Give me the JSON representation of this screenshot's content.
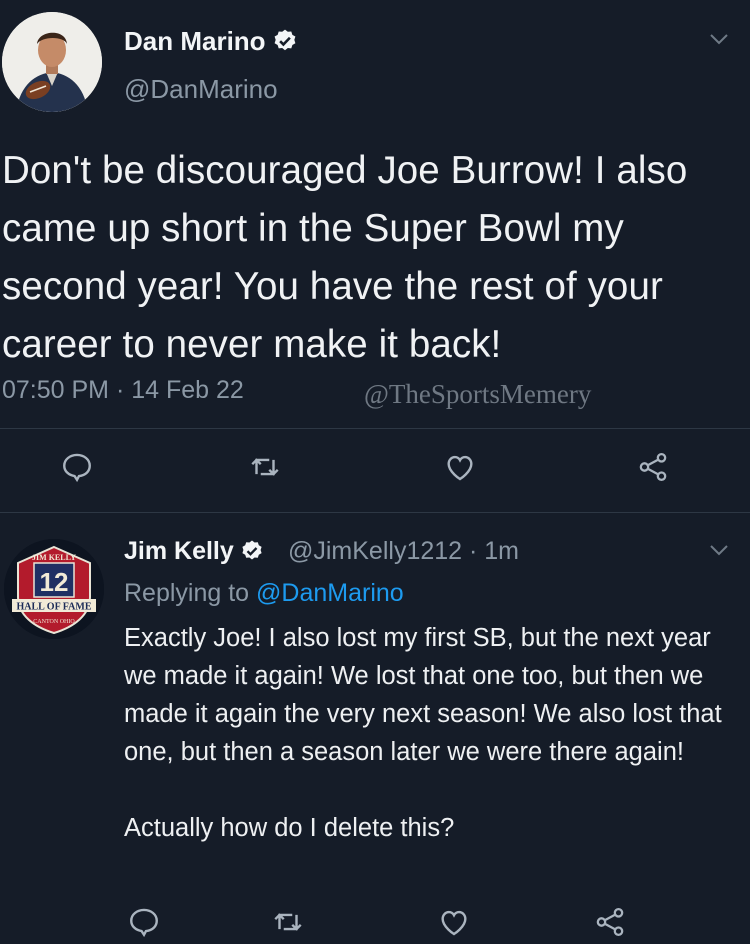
{
  "colors": {
    "background": "#151c28",
    "text": "#f0f2f4",
    "muted": "#8b98a5",
    "link": "#1d9bf0",
    "divider": "#2d3744"
  },
  "tweet1": {
    "author_name": "Dan Marino",
    "handle": "@DanMarino",
    "text": "Don't be discouraged Joe Burrow! I also came up short in the Super Bowl my second year! You have the rest of your career to never make it back!",
    "timestamp": "07:50 PM · 14 Feb 22",
    "watermark": "@TheSportsMemery",
    "actions": [
      "reply-icon",
      "retweet-icon",
      "like-icon",
      "share-icon"
    ]
  },
  "tweet2": {
    "author_name": "Jim Kelly",
    "handle_time": "@JimKelly1212 · 1m",
    "replying_prefix": "Replying to",
    "replying_to": "@DanMarino",
    "text_paragraph1": "Exactly Joe! I also lost my first SB, but the next year we made it again! We lost that one too, but then we made it again the very next season! We also lost that one, but then a season later we were there again!",
    "text_paragraph2": "Actually how do I delete this?",
    "avatar_badge": {
      "top": "JIM KELLY",
      "number": "12",
      "banner": "HALL OF FAME",
      "bottom": "CANTON OHIO"
    },
    "actions": [
      "reply-icon",
      "retweet-icon",
      "like-icon",
      "share-icon"
    ]
  }
}
